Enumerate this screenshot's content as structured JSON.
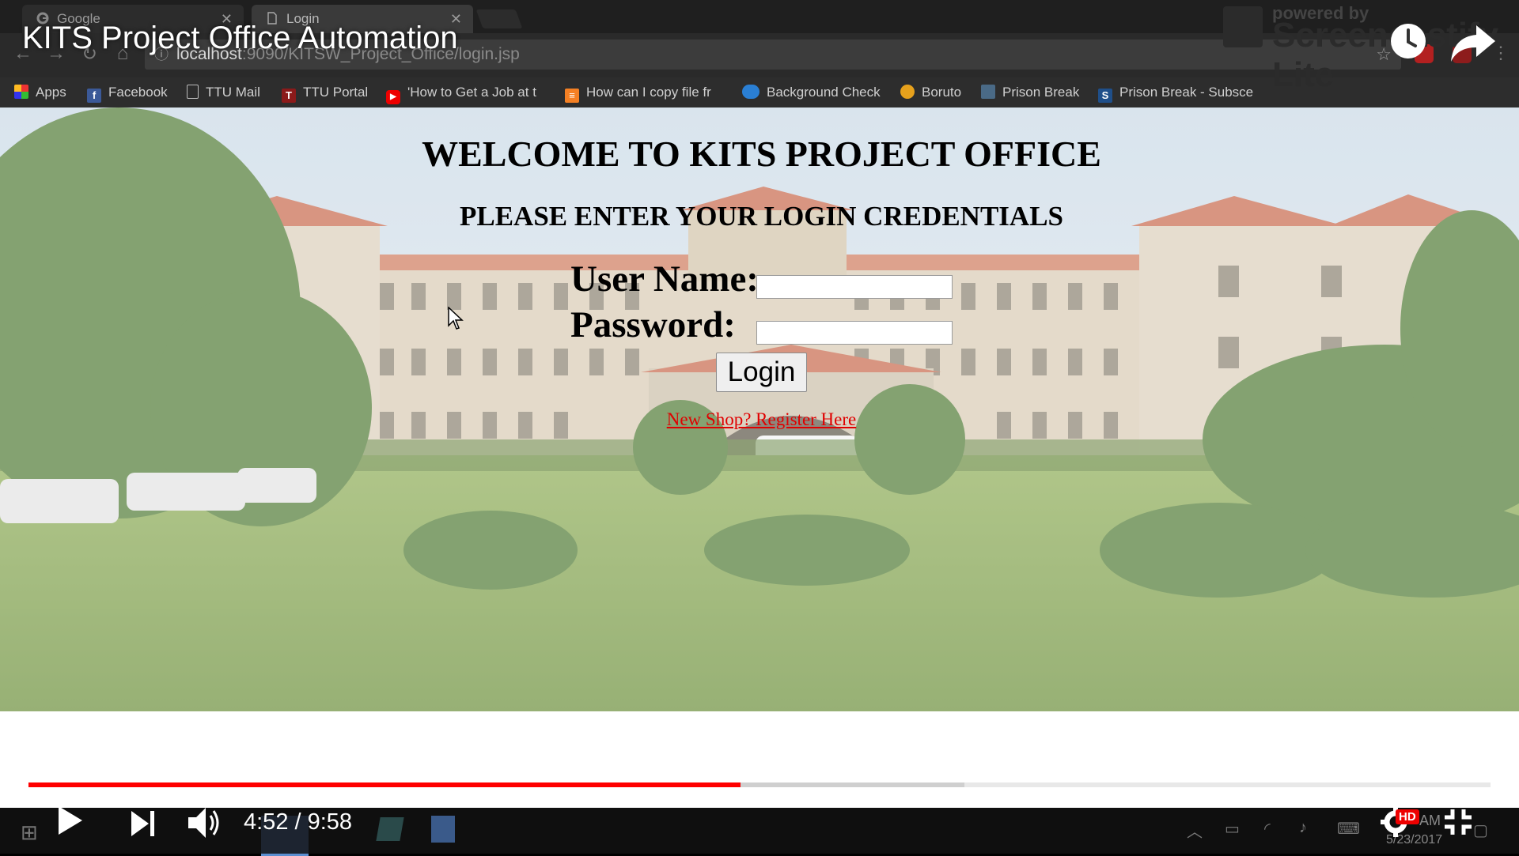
{
  "browser": {
    "tabs": [
      {
        "label": "Google",
        "icon": "google-icon"
      },
      {
        "label": "Login",
        "icon": "page-icon"
      }
    ],
    "url_host": "localhost",
    "url_rest": ":9090/KITSW_Project_Office/login.jsp",
    "bookmarks": [
      {
        "label": "Apps",
        "icon": "apps-icon"
      },
      {
        "label": "Facebook",
        "icon": "facebook-icon"
      },
      {
        "label": "TTU Mail",
        "icon": "page-icon"
      },
      {
        "label": "TTU Portal",
        "icon": "ttu-icon"
      },
      {
        "label": "'How to Get a Job at t",
        "icon": "youtube-icon"
      },
      {
        "label": "How can I copy file fr",
        "icon": "stackoverflow-icon"
      },
      {
        "label": "Background Check",
        "icon": "cloud-icon"
      },
      {
        "label": "Boruto",
        "icon": "boruto-icon"
      },
      {
        "label": "Prison Break",
        "icon": "prison-break-icon"
      },
      {
        "label": "Prison Break - Subsce",
        "icon": "subscene-icon"
      }
    ]
  },
  "page": {
    "heading": "WELCOME TO KITS PROJECT OFFICE",
    "subheading": "PLEASE ENTER YOUR LOGIN CREDENTIALS",
    "username_label": "User Name:",
    "password_label": "Password:",
    "username_value": "",
    "password_value": "",
    "login_button": "Login",
    "register_link": "New Shop? Register Here"
  },
  "video": {
    "title": "KITS Project Office Automation",
    "watermark_small": "powered by",
    "watermark_big": "Screencastify Lite",
    "time_current": "4:52",
    "time_total": "9:58",
    "time_display": "4:52 / 9:58",
    "progress_fraction": 0.487,
    "buffered_fraction": 0.64,
    "hd_badge": "HD",
    "colors": {
      "played": "#ff0000",
      "accent_link": "#e00000"
    }
  },
  "taskbar": {
    "clock_am": "AM",
    "date": "5/23/2017"
  }
}
